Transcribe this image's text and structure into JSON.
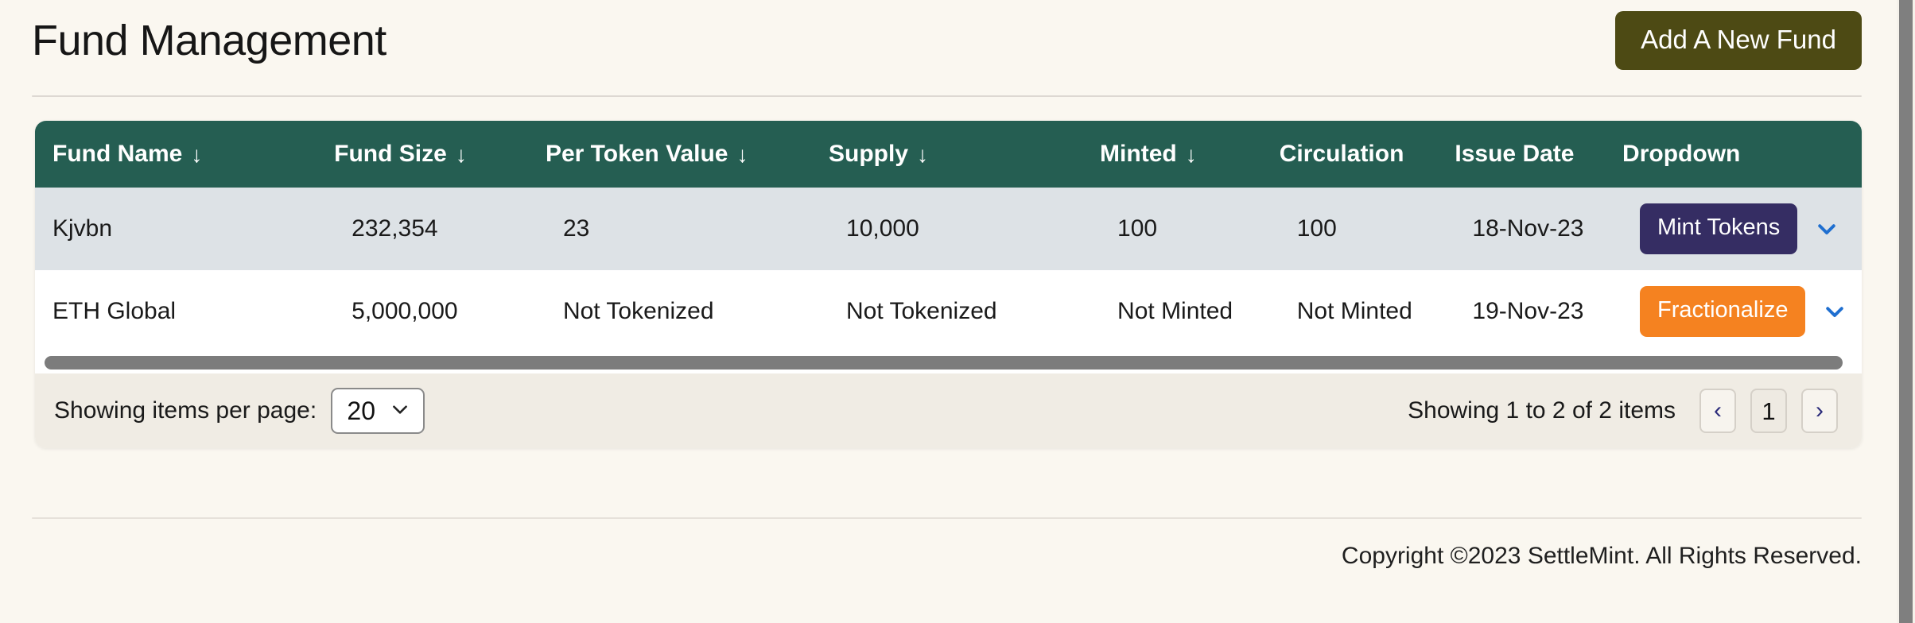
{
  "header": {
    "title": "Fund Management",
    "add_button_label": "Add A New Fund"
  },
  "table": {
    "columns": [
      {
        "label": "Fund Name",
        "sortable": true,
        "sort_icon": "arrow-down-icon"
      },
      {
        "label": "Fund Size",
        "sortable": true,
        "sort_icon": "arrow-down-icon"
      },
      {
        "label": "Per Token Value",
        "sortable": true,
        "sort_icon": "arrow-down-icon"
      },
      {
        "label": "Supply",
        "sortable": true,
        "sort_icon": "arrow-down-icon"
      },
      {
        "label": "Minted",
        "sortable": true,
        "sort_icon": "arrow-down-icon"
      },
      {
        "label": "Circulation",
        "sortable": false,
        "sort_icon": ""
      },
      {
        "label": "Issue Date",
        "sortable": false,
        "sort_icon": ""
      },
      {
        "label": "Dropdown",
        "sortable": false,
        "sort_icon": ""
      }
    ],
    "sort_arrow_glyph": "↓",
    "rows": [
      {
        "fund_name": "Kjvbn",
        "fund_size": "232,354",
        "per_token_value": "23",
        "supply": "10,000",
        "minted": "100",
        "circulation": "100",
        "issue_date": "18-Nov-23",
        "action_label": "Mint Tokens",
        "action_color": "#352d63",
        "dropdown_icon": "chevron-down-icon"
      },
      {
        "fund_name": "ETH Global",
        "fund_size": "5,000,000",
        "per_token_value": "Not Tokenized",
        "supply": "Not Tokenized",
        "minted": "Not Minted",
        "circulation": "Not Minted",
        "issue_date": "19-Nov-23",
        "action_label": "Fractionalize",
        "action_color": "#f58220",
        "dropdown_icon": "chevron-down-icon"
      }
    ]
  },
  "pagination": {
    "per_page_label": "Showing items per page:",
    "per_page_value": "20",
    "per_page_options": [
      "20"
    ],
    "status": "Showing 1 to 2 of 2 items",
    "prev_glyph": "‹",
    "next_glyph": "›",
    "current_page": "1"
  },
  "footer": {
    "copyright": "Copyright ©2023 SettleMint. All Rights Reserved."
  },
  "colors": {
    "page_background": "#faf7f0",
    "table_header": "#255e52",
    "row_alt": "#dde2e6",
    "accent_olive": "#4d4a14",
    "accent_indigo": "#352d63",
    "accent_orange": "#f58220",
    "pagination_bar": "#f0ece4",
    "chevron_blue": "#1f6fd0"
  }
}
